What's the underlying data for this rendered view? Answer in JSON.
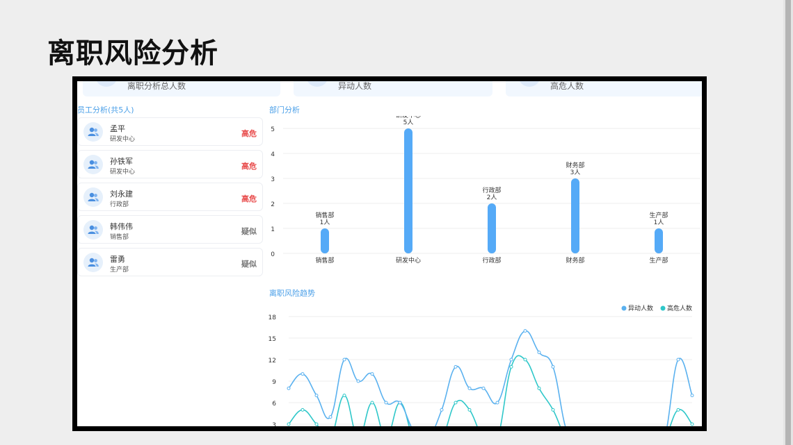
{
  "page": {
    "title": "离职风险分析"
  },
  "stats": [
    {
      "label": "离职分析总人数"
    },
    {
      "label": "异动人数"
    },
    {
      "label": "高危人数"
    }
  ],
  "employees": {
    "title": "员工分析(共5人)",
    "items": [
      {
        "name": "孟平",
        "dept": "研发中心",
        "level": "高危"
      },
      {
        "name": "孙铁军",
        "dept": "研发中心",
        "level": "高危"
      },
      {
        "name": "刘永建",
        "dept": "行政部",
        "level": "高危"
      },
      {
        "name": "韩伟伟",
        "dept": "销售部",
        "level": "疑似"
      },
      {
        "name": "雷勇",
        "dept": "生产部",
        "level": "疑似"
      }
    ]
  },
  "colors": {
    "bar": "#55aaf7",
    "series_yidong": "#5ab1ef",
    "series_gaowei": "#2ec7c9",
    "level_high": "#e84b4b",
    "level_suspect": "#777777"
  },
  "chart_data": [
    {
      "type": "bar",
      "title": "部门分析",
      "categories": [
        "销售部",
        "研发中心",
        "行政部",
        "财务部",
        "生产部"
      ],
      "values": [
        1,
        5,
        2,
        3,
        1
      ],
      "value_labels": [
        "1人",
        "5人",
        "2人",
        "3人",
        "1人"
      ],
      "ylim": [
        0,
        5
      ],
      "yticks": [
        0,
        1,
        2,
        3,
        4,
        5
      ],
      "grid": true
    },
    {
      "type": "line",
      "title": "离职风险趋势",
      "yticks": [
        3,
        6,
        9,
        12,
        15,
        18
      ],
      "ylim": [
        3,
        18
      ],
      "grid": true,
      "legend_position": "top-right",
      "series": [
        {
          "name": "异动人数",
          "values": [
            8,
            10,
            7,
            4,
            12,
            9,
            10,
            6,
            6,
            2,
            1,
            5,
            11,
            8,
            8,
            6,
            12,
            16,
            13,
            11,
            2,
            1,
            1,
            1,
            1,
            1,
            1,
            1,
            12,
            7
          ]
        },
        {
          "name": "高危人数",
          "values": [
            3,
            5,
            3,
            1,
            7,
            1,
            6,
            1,
            6,
            1,
            1,
            1,
            6,
            5,
            1,
            1,
            11,
            12,
            8,
            5,
            1,
            1,
            1,
            1,
            1,
            1,
            1,
            1,
            5,
            3
          ]
        }
      ]
    }
  ]
}
